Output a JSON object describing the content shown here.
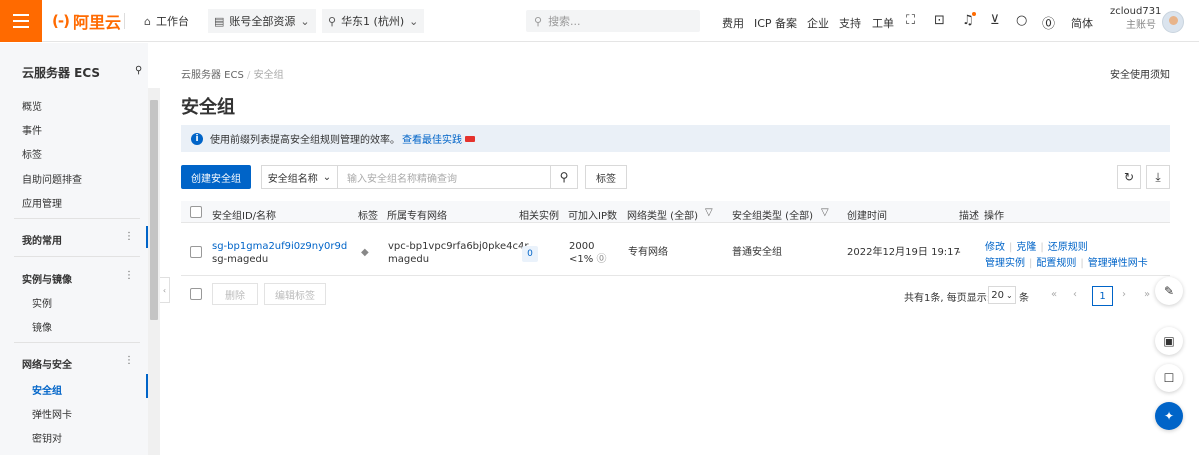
{
  "topbar": {
    "logo_text": "阿里云",
    "workbench": "工作台",
    "resources": "账号全部资源",
    "region": "华东1 (杭州)",
    "search_placeholder": "搜索...",
    "nav": [
      "费用",
      "ICP 备案",
      "企业",
      "支持",
      "工单"
    ],
    "lang": "简体",
    "username": "zcloud731",
    "account_type": "主账号",
    "accent_color": "#ff6a00"
  },
  "sidebar": {
    "title": "云服务器 ECS",
    "top_links": [
      "概览",
      "事件",
      "标签",
      "自助问题排查",
      "应用管理"
    ],
    "favorites": "我的常用",
    "group_instances": "实例与镜像",
    "instances_items": [
      "实例",
      "镜像"
    ],
    "group_network": "网络与安全",
    "network_items": [
      "安全组",
      "弹性网卡",
      "密钥对"
    ],
    "active_color": "#0064c8"
  },
  "main": {
    "breadcrumb_root": "云服务器 ECS",
    "breadcrumb_sep": "/",
    "breadcrumb_current": "安全组",
    "notice_link": "安全使用须知",
    "title": "安全组",
    "tip_text": "使用前缀列表提高安全组规则管理的效率。",
    "tip_link": "查看最佳实践",
    "create_button": "创建安全组",
    "filter_field": "安全组名称",
    "filter_placeholder": "输入安全组名称精确查询",
    "tag_button": "标签"
  },
  "table": {
    "headers": {
      "id_name": "安全组ID/名称",
      "tag": "标签",
      "vpc": "所属专有网络",
      "related": "相关实例",
      "ip_count": "可加入IP数",
      "net_type": "网络类型 (全部)",
      "sg_type": "安全组类型 (全部)",
      "created": "创建时间",
      "desc": "描述",
      "ops": "操作"
    },
    "rows": [
      {
        "id": "sg-bp1gma2uf9i0z9ny0r9d",
        "name": "sg-magedu",
        "vpc_id": "vpc-bp1vpc9rfa6bj0pke4c4r",
        "vpc_name": "magedu",
        "related": "0",
        "ip_count": "2000",
        "ip_usage": "<1%",
        "net_type": "专有网络",
        "sg_type": "普通安全组",
        "created": "2022年12月19日 19:17",
        "desc": "-",
        "ops_line1": [
          "修改",
          "克隆",
          "还原规则"
        ],
        "ops_line2": [
          "管理实例",
          "配置规则",
          "管理弹性网卡"
        ]
      }
    ]
  },
  "footer": {
    "delete_button": "删除",
    "edit_tags_button": "编辑标签",
    "total_text": "共有1条, 每页显示:",
    "page_size": "20",
    "page_size_unit": "条",
    "current_page": "1"
  }
}
